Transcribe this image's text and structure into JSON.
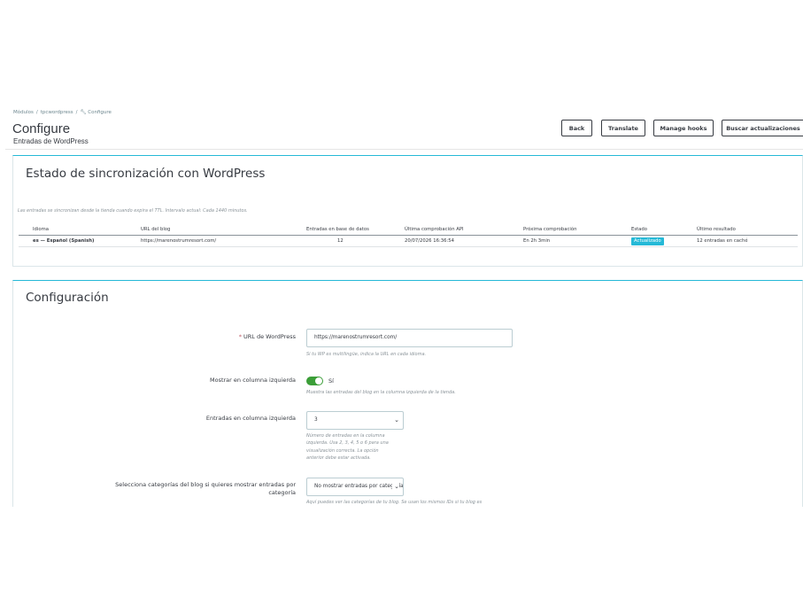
{
  "breadcrumb": [
    "Módulos",
    "tpcwordpress",
    "Configure"
  ],
  "header": {
    "title": "Configure",
    "subtitle": "Entradas de WordPress"
  },
  "toolbar": {
    "back": "Back",
    "translate": "Translate",
    "hooks": "Manage hooks",
    "updates": "Buscar actualizaciones"
  },
  "sync": {
    "title": "Estado de sincronización con WordPress",
    "note": "Las entradas se sincronizan desde la tienda cuando expira el TTL. Intervalo actual: Cada 1440 minutos.",
    "columns": [
      "Idioma",
      "URL del blog",
      "Entradas en base de datos",
      "Última comprobación API",
      "Próxima comprobación",
      "Estado",
      "Último resultado"
    ],
    "row": {
      "language": "es — Español (Spanish)",
      "url": "https://marenostrumresort.com/",
      "entries": "12",
      "last_check": "20/07/2026 16:36:54",
      "next_check": "En 2h 3min",
      "status": "Actualizado",
      "result": "12 entradas en caché"
    }
  },
  "config": {
    "title": "Configuración",
    "wp_url": {
      "label": "URL de WordPress",
      "value": "https://marenostrumresort.com/",
      "help": "Si tu WP es multilingüe, indica la URL en cada idioma."
    },
    "left_col": {
      "label": "Mostrar en columna izquierda",
      "value_label": "Sí",
      "help": "Muestra las entradas del blog en la columna izquierda de la tienda."
    },
    "entries_left": {
      "label": "Entradas en columna izquierda",
      "value": "3",
      "help": [
        "Número de entradas en la columna",
        "izquierda. Usa 2, 3, 4, 5 o 6 para una",
        "visualización correcta. La opción",
        "anterior debe estar activada."
      ]
    },
    "categories": {
      "label_line1": "Selecciona categorías del blog si quieres mostrar entradas por",
      "label_line2": "categoría",
      "value": "No mostrar entradas por categoría",
      "help": "Aquí puedes ver las categorías de tu blog. Se usan los mismos IDs si tu blog es"
    }
  },
  "colors": {
    "accent": "#25b9d7",
    "toggle_on": "#3b9e38",
    "required": "#c05c67"
  }
}
